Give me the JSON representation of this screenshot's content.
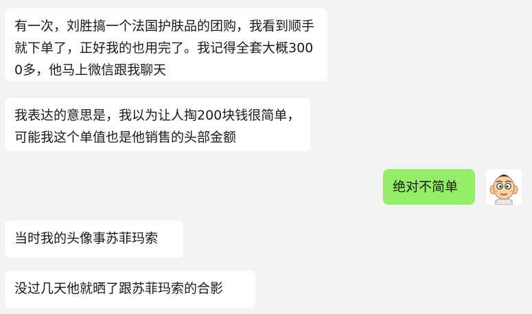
{
  "messages": [
    {
      "text": "有一次，刘胜搞一个法国护肤品的团购，我看到顺手就下单了，正好我的也用完了。我记得全套大概3000多，他马上微信跟我聊天"
    },
    {
      "text": "我表达的意思是，我以为让人掏200块钱很简单，可能我这个单值也是他销售的头部金额"
    },
    {
      "text": "绝对不简单"
    },
    {
      "text": "当时我的头像事苏菲玛索"
    },
    {
      "text": "没过几天他就晒了跟苏菲玛索的合影"
    }
  ],
  "colors": {
    "background": "#f3f3f3",
    "incoming_bubble": "#ffffff",
    "outgoing_bubble": "#95ec69"
  },
  "avatar": {
    "icon": "cartoon-boy-avatar-icon"
  }
}
